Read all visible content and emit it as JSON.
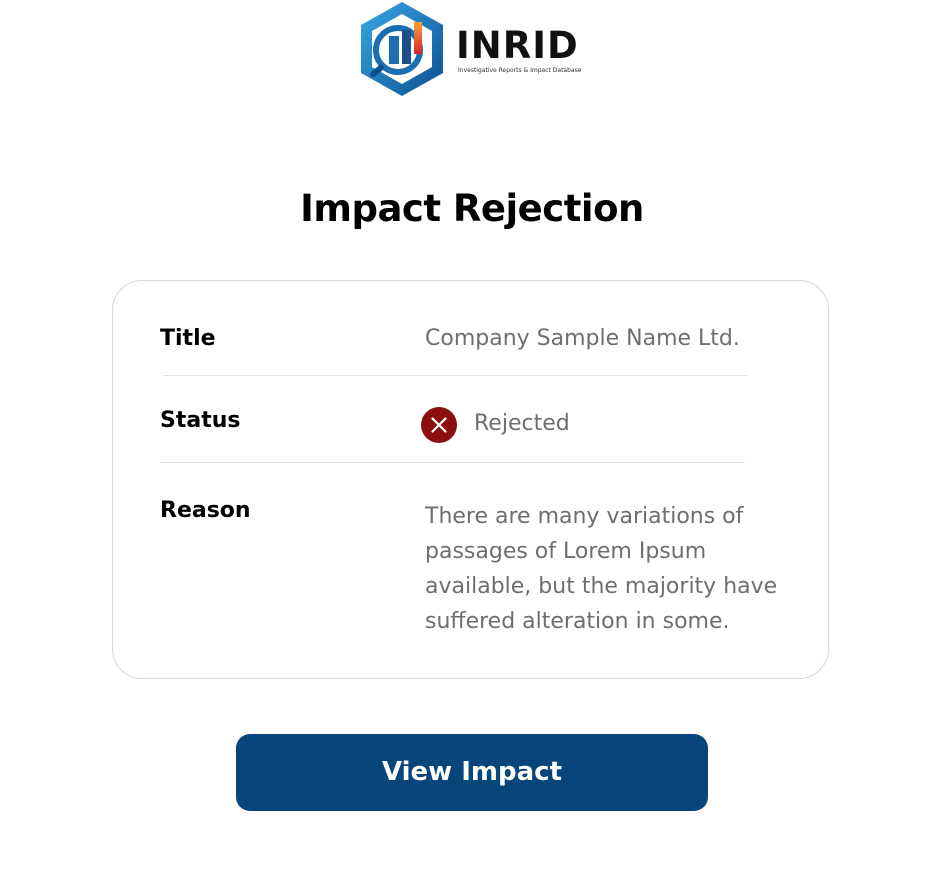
{
  "logo": {
    "wordmark": "INRID",
    "tagline": "Investigative Reports & Impact Database"
  },
  "page": {
    "title": "Impact Rejection"
  },
  "details": {
    "title_label": "Title",
    "title_value": "Company Sample Name Ltd.",
    "status_label": "Status",
    "status_value": "Rejected",
    "status_icon": "x-circle-icon",
    "reason_label": "Reason",
    "reason_lines": [
      "There are many variations of",
      "passages of Lorem Ipsum",
      "available, but the majority have",
      "suffered alteration in some."
    ]
  },
  "actions": {
    "primary_label": "View Impact"
  },
  "colors": {
    "primary": "#07457b",
    "rejected": "#8b0f0f",
    "muted_text": "#6e6e6e",
    "border": "#d6d6d6"
  }
}
